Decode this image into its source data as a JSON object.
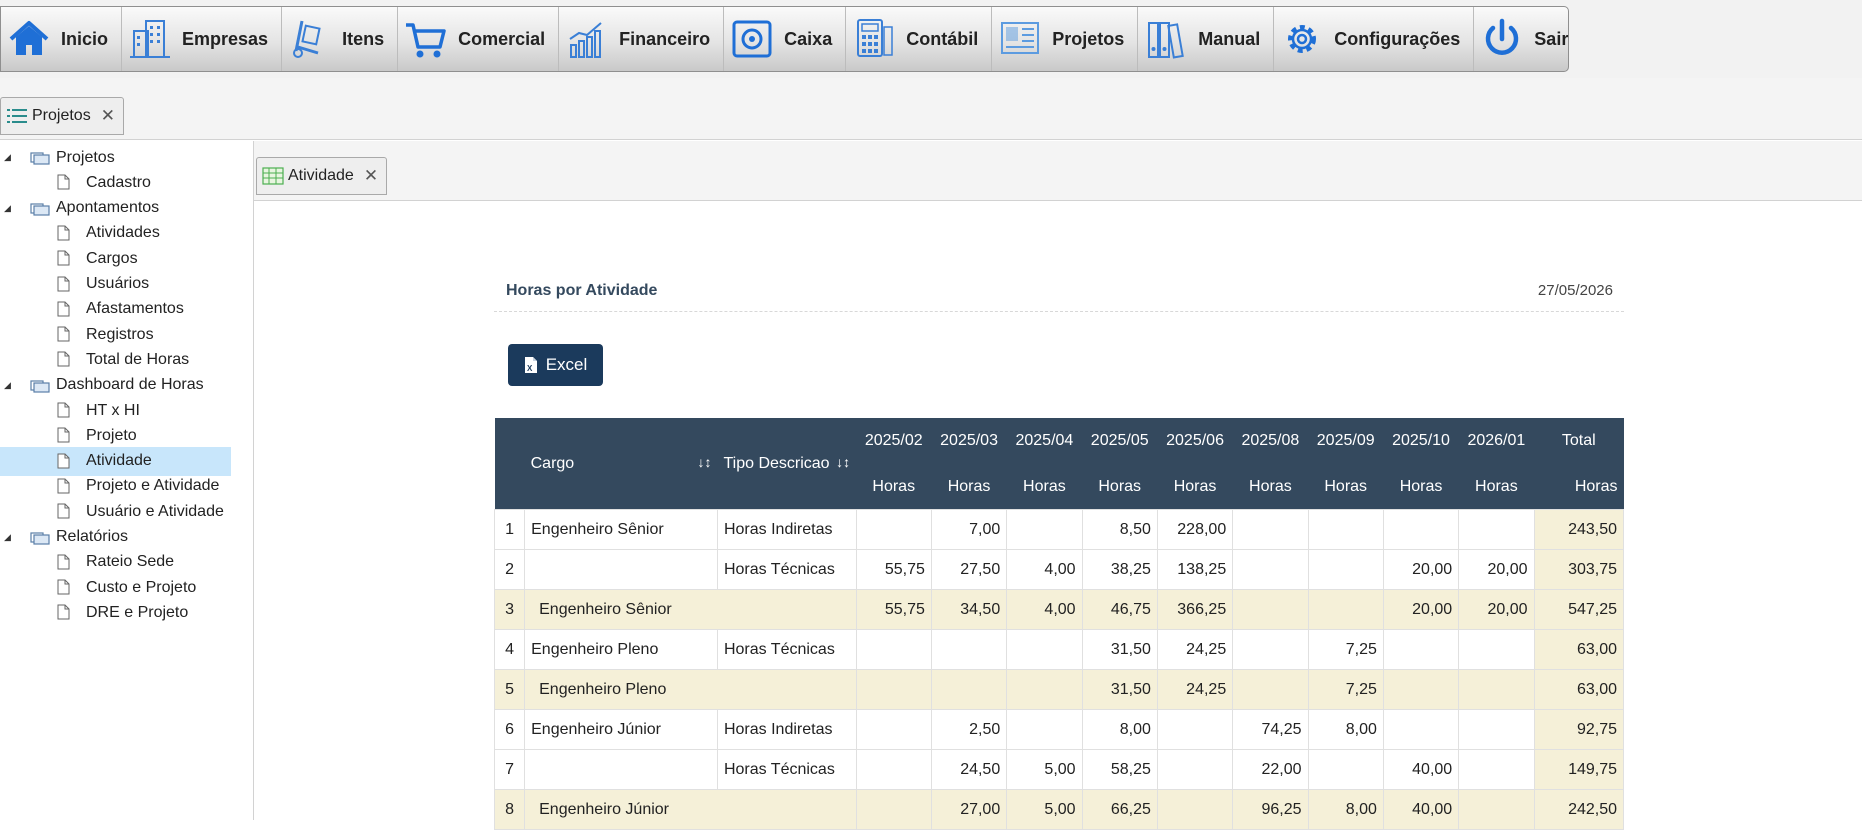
{
  "menu": [
    {
      "label": "Inicio",
      "icon": "home-icon",
      "color": "#1f6fd6"
    },
    {
      "label": "Empresas",
      "icon": "buildings-icon",
      "color": "#3a7fd6"
    },
    {
      "label": "Itens",
      "icon": "hand-truck-icon",
      "color": "#3a7fd6"
    },
    {
      "label": "Comercial",
      "icon": "shopping-cart-icon",
      "color": "#1f6fd6"
    },
    {
      "label": "Financeiro",
      "icon": "bar-chart-icon",
      "color": "#3a7fd6"
    },
    {
      "label": "Caixa",
      "icon": "safe-icon",
      "color": "#1f6fd6"
    },
    {
      "label": "Contábil",
      "icon": "calculator-icon",
      "color": "#3a7fd6"
    },
    {
      "label": "Projetos",
      "icon": "project-board-icon",
      "color": "#5c9be0"
    },
    {
      "label": "Manual",
      "icon": "binders-icon",
      "color": "#3a7fd6"
    },
    {
      "label": "Configurações",
      "icon": "gear-icon",
      "color": "#1f6fd6"
    },
    {
      "label": "Sair",
      "icon": "power-icon",
      "color": "#1f6fd6"
    }
  ],
  "outer_tab": {
    "label": "Projetos",
    "close": "✕"
  },
  "inner_tab": {
    "label": "Atividade",
    "close": "✕"
  },
  "sidebar": {
    "folders": [
      {
        "label": "Projetos",
        "items": [
          "Cadastro"
        ]
      },
      {
        "label": "Apontamentos",
        "items": [
          "Atividades",
          "Cargos",
          "Usuários",
          "Afastamentos",
          "Registros",
          "Total de Horas"
        ]
      },
      {
        "label": "Dashboard de Horas",
        "items": [
          "HT x HI",
          "Projeto",
          "Atividade",
          "Projeto e Atividade",
          "Usuário e Atividade"
        ]
      },
      {
        "label": "Relatórios",
        "items": [
          "Rateio Sede",
          "Custo e Projeto",
          "DRE e Projeto"
        ]
      }
    ],
    "selected": "Atividade"
  },
  "report": {
    "title": "Horas por Atividade",
    "date": "27/05/2026",
    "excel_label": "Excel"
  },
  "table": {
    "header_cargo": "Cargo",
    "header_tipo": "Tipo Descricao",
    "months": [
      "2025/02",
      "2025/03",
      "2025/04",
      "2025/05",
      "2025/06",
      "2025/08",
      "2025/09",
      "2025/10",
      "2026/01"
    ],
    "total_label": "Total",
    "sub_label": "Horas",
    "rows": [
      {
        "n": "1",
        "cargo": "Engenheiro Sênior",
        "tipo": "Horas Indiretas",
        "vals": [
          "",
          "7,00",
          "",
          "8,50",
          "228,00",
          "",
          "",
          "",
          ""
        ],
        "total": "243,50",
        "subtotal": false
      },
      {
        "n": "2",
        "cargo": "",
        "tipo": "Horas Técnicas",
        "vals": [
          "55,75",
          "27,50",
          "4,00",
          "38,25",
          "138,25",
          "",
          "",
          "20,00",
          "20,00"
        ],
        "total": "303,75",
        "subtotal": false
      },
      {
        "n": "3",
        "cargo": "Engenheiro Sênior",
        "tipo": "",
        "vals": [
          "55,75",
          "34,50",
          "4,00",
          "46,75",
          "366,25",
          "",
          "",
          "20,00",
          "20,00"
        ],
        "total": "547,25",
        "subtotal": true
      },
      {
        "n": "4",
        "cargo": "Engenheiro Pleno",
        "tipo": "Horas Técnicas",
        "vals": [
          "",
          "",
          "",
          "31,50",
          "24,25",
          "",
          "7,25",
          "",
          ""
        ],
        "total": "63,00",
        "subtotal": false
      },
      {
        "n": "5",
        "cargo": "Engenheiro Pleno",
        "tipo": "",
        "vals": [
          "",
          "",
          "",
          "31,50",
          "24,25",
          "",
          "7,25",
          "",
          ""
        ],
        "total": "63,00",
        "subtotal": true
      },
      {
        "n": "6",
        "cargo": "Engenheiro Júnior",
        "tipo": "Horas Indiretas",
        "vals": [
          "",
          "2,50",
          "",
          "8,00",
          "",
          "74,25",
          "8,00",
          "",
          ""
        ],
        "total": "92,75",
        "subtotal": false
      },
      {
        "n": "7",
        "cargo": "",
        "tipo": "Horas Técnicas",
        "vals": [
          "",
          "24,50",
          "5,00",
          "58,25",
          "",
          "22,00",
          "",
          "40,00",
          ""
        ],
        "total": "149,75",
        "subtotal": false
      },
      {
        "n": "8",
        "cargo": "Engenheiro Júnior",
        "tipo": "",
        "vals": [
          "",
          "27,00",
          "5,00",
          "66,25",
          "",
          "96,25",
          "8,00",
          "40,00",
          ""
        ],
        "total": "242,50",
        "subtotal": true
      }
    ]
  }
}
